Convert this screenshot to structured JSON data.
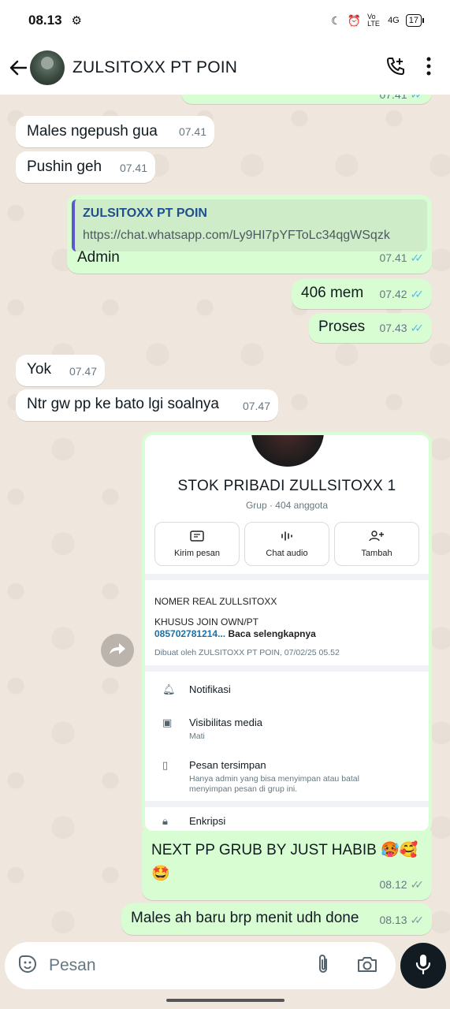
{
  "status_bar": {
    "time": "08.13",
    "network": "Vo LTE",
    "signal": "4G",
    "battery": "17"
  },
  "header": {
    "title": "ZULSITOXX PT POIN"
  },
  "messages": [
    {
      "text": "Males ngepush gua",
      "time": "07.41"
    },
    {
      "text": "Pushin geh",
      "time": "07.41"
    },
    {
      "quote_title": "ZULSITOXX PT POIN",
      "quote_url": "https://chat.whatsapp.com/Ly9HI7pYFToLc34qgWSqzk",
      "text": "Admin",
      "time": "07.41"
    },
    {
      "text": "406 mem",
      "time": "07.42"
    },
    {
      "text": "Proses",
      "time": "07.43"
    },
    {
      "text": "Yok",
      "time": "07.47"
    },
    {
      "text": "Ntr gw pp ke bato lgi soalnya",
      "time": "07.47"
    },
    {
      "text": "NEXT PP GRUB BY JUST HABIB 🥵🥰\n🤩",
      "time": "08.12"
    },
    {
      "text": "Males ah baru brp menit udh done",
      "time": "08.13"
    }
  ],
  "top_partial_time": "07.41",
  "shared_screenshot": {
    "group_name": "STOK PRIBADI ZULLSITOXX 1",
    "group_sub": "Grup · 404 anggota",
    "actions": [
      "Kirim pesan",
      "Chat audio",
      "Tambah"
    ],
    "desc_title": "NOMER REAL ZULLSITOXX",
    "desc_line": "KHUSUS JOIN OWN/PT",
    "desc_number": "085702781214...",
    "desc_more": "Baca selengkapnya",
    "created_by": "Dibuat oleh ZULSITOXX PT POIN, 07/02/25 05.52",
    "options": [
      {
        "title": "Notifikasi",
        "sub": ""
      },
      {
        "title": "Visibilitas media",
        "sub": "Mati"
      },
      {
        "title": "Pesan tersimpan",
        "sub": "Hanya admin yang bisa menyimpan atau batal menyimpan pesan di grup ini."
      },
      {
        "title": "Enkripsi",
        "sub": ""
      }
    ]
  },
  "input": {
    "placeholder": "Pesan"
  }
}
